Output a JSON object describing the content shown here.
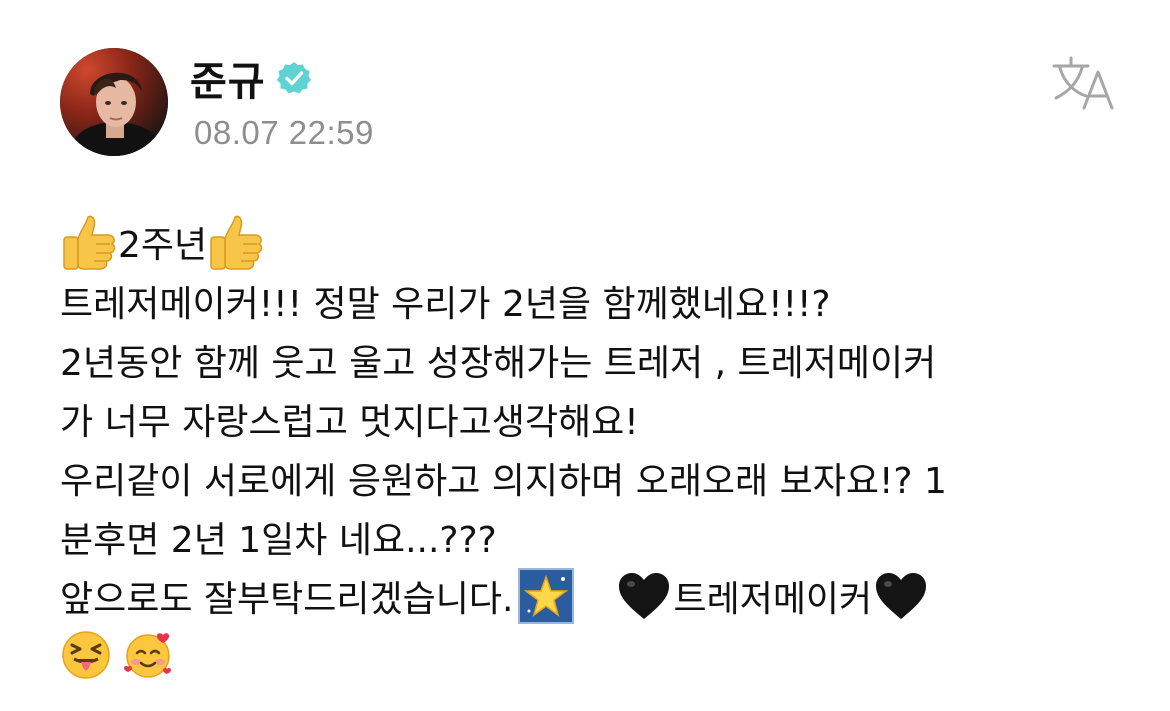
{
  "post": {
    "author": {
      "name": "준규",
      "verified": true,
      "avatar": "profile-photo"
    },
    "timestamp": "08.07 22:59",
    "translate_icon": "translate-icon",
    "body": {
      "line1_text": "2주년",
      "line2": "트레저메이커!!! 정말 우리가 2년을 함께했네요!!!?",
      "line3": "2년동안 함께 웃고 울고 성장해가는 트레저 , 트레저메이커",
      "line4": "가 너무 자랑스럽고 멋지다고생각해요!",
      "line5": "우리같이 서로에게 응원하고 의지하며 오래오래 보자요!? 1",
      "line6": "분후면 2년 1일차 네요...???",
      "line7_text": "앞으로도 잘부탁드리겠습니다.",
      "line7_tail": "트레저메이커"
    },
    "emoji_icons": [
      "thumbs-up-icon",
      "glowing-star-icon",
      "black-heart-icon",
      "squinting-tongue-face-icon",
      "smiling-face-with-hearts-icon"
    ]
  },
  "colors": {
    "verified_badge": "#5fd3d4",
    "timestamp": "#8e8e8e",
    "text": "#111111",
    "icon_gray": "#a6a6a6"
  }
}
